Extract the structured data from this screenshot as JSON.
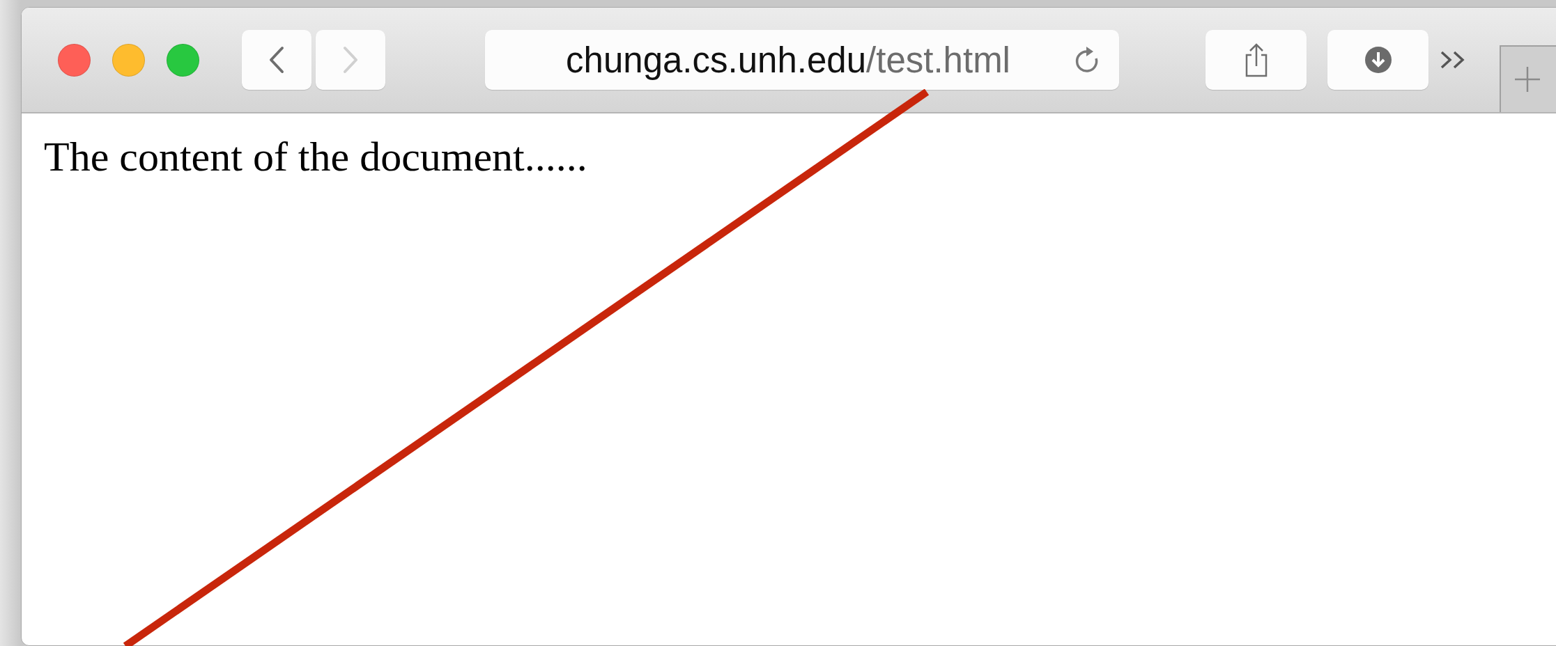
{
  "window": {
    "buttons": [
      {
        "color": "#fe5f57"
      },
      {
        "color": "#febc2e"
      },
      {
        "color": "#28c840"
      }
    ]
  },
  "navigation": [
    {
      "kind": "back",
      "disabled": false
    },
    {
      "kind": "forward",
      "disabled": true
    }
  ],
  "address_bar": {
    "host": "chunga.cs.unh.edu",
    "path": "/test.html"
  },
  "page": {
    "text": "The content of the document......"
  }
}
